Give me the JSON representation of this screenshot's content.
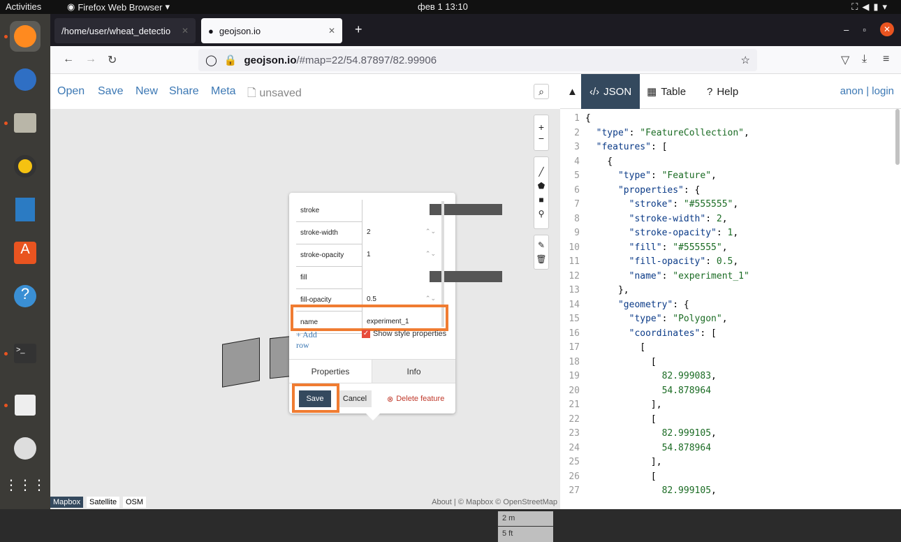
{
  "topbar": {
    "activities": "Activities",
    "app": "Firefox Web Browser",
    "clock": "фев 1  13:10"
  },
  "browser": {
    "tab1": "/home/user/wheat_detectio",
    "tab2": "geojson.io",
    "url_host": "geojson.io",
    "url_rest": "/#map=22/54.87897/82.99906"
  },
  "app": {
    "menu": [
      "Open",
      "Save",
      "New",
      "Share",
      "Meta"
    ],
    "unsaved": "unsaved",
    "panel_tabs": [
      "JSON",
      "Table",
      "Help"
    ],
    "login": "anon | login"
  },
  "popup": {
    "rows": [
      {
        "key": "stroke",
        "value": ""
      },
      {
        "key": "stroke-width",
        "value": "2"
      },
      {
        "key": "stroke-opacity",
        "value": "1"
      },
      {
        "key": "fill",
        "value": ""
      },
      {
        "key": "fill-opacity",
        "value": "0.5"
      },
      {
        "key": "name",
        "value": "experiment_1"
      }
    ],
    "add_row": "+ Add row",
    "show_style": "Show style properties",
    "tabs": [
      "Properties",
      "Info"
    ],
    "save": "Save",
    "cancel": "Cancel",
    "delete": "Delete feature",
    "swatch_color": "#555555"
  },
  "map": {
    "scale_m": "2 m",
    "scale_ft": "5 ft",
    "layers": [
      "Mapbox",
      "Satellite",
      "OSM"
    ],
    "attribution": "About | © Mapbox © OpenStreetMap"
  },
  "code_lines": [
    {
      "n": "1",
      "t": "{"
    },
    {
      "n": "2",
      "t": "  \"type\": \"FeatureCollection\","
    },
    {
      "n": "3",
      "t": "  \"features\": ["
    },
    {
      "n": "4",
      "t": "    {"
    },
    {
      "n": "5",
      "t": "      \"type\": \"Feature\","
    },
    {
      "n": "6",
      "t": "      \"properties\": {"
    },
    {
      "n": "7",
      "t": "        \"stroke\": \"#555555\","
    },
    {
      "n": "8",
      "t": "        \"stroke-width\": 2,"
    },
    {
      "n": "9",
      "t": "        \"stroke-opacity\": 1,"
    },
    {
      "n": "10",
      "t": "        \"fill\": \"#555555\","
    },
    {
      "n": "11",
      "t": "        \"fill-opacity\": 0.5,"
    },
    {
      "n": "12",
      "t": "        \"name\": \"experiment_1\""
    },
    {
      "n": "13",
      "t": "      },"
    },
    {
      "n": "14",
      "t": "      \"geometry\": {"
    },
    {
      "n": "15",
      "t": "        \"type\": \"Polygon\","
    },
    {
      "n": "16",
      "t": "        \"coordinates\": ["
    },
    {
      "n": "17",
      "t": "          ["
    },
    {
      "n": "18",
      "t": "            ["
    },
    {
      "n": "19",
      "t": "              82.999083,"
    },
    {
      "n": "20",
      "t": "              54.878964"
    },
    {
      "n": "21",
      "t": "            ],"
    },
    {
      "n": "22",
      "t": "            ["
    },
    {
      "n": "23",
      "t": "              82.999105,"
    },
    {
      "n": "24",
      "t": "              54.878964"
    },
    {
      "n": "25",
      "t": "            ],"
    },
    {
      "n": "26",
      "t": "            ["
    },
    {
      "n": "27",
      "t": "              82.999105,"
    }
  ],
  "colors": {
    "accent": "#f07c32",
    "panel_tab": "#34495e",
    "link": "#3c78b4"
  }
}
